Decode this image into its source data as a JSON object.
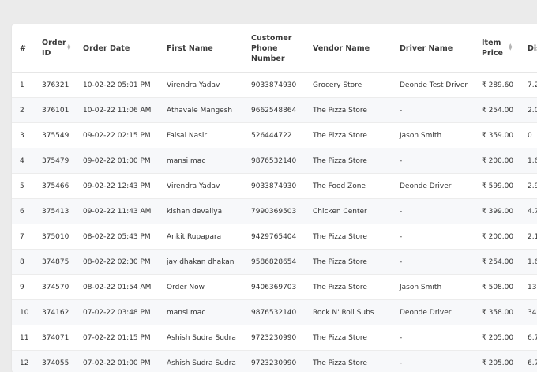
{
  "table": {
    "headers": {
      "index": "#",
      "order_id": "Order ID",
      "order_date": "Order Date",
      "first_name": "First Name",
      "customer_phone": "Customer Phone Number",
      "vendor_name": "Vendor Name",
      "driver_name": "Driver Name",
      "item_price": "Item Price",
      "discount": "Dis"
    },
    "sort_icon": "sort-updown-icon",
    "rows": [
      {
        "idx": "1",
        "order_id": "376321",
        "date": "10-02-22 05:01 PM",
        "first_name": "Virendra Yadav",
        "phone": "9033874930",
        "vendor": "Grocery Store",
        "driver": "Deonde Test Driver",
        "price": "₹ 289.60",
        "disc": "7.2"
      },
      {
        "idx": "2",
        "order_id": "376101",
        "date": "10-02-22 11:06 AM",
        "first_name": "Athavale Mangesh",
        "phone": "9662548864",
        "vendor": "The Pizza Store",
        "driver": "-",
        "price": "₹ 254.00",
        "disc": "2.0"
      },
      {
        "idx": "3",
        "order_id": "375549",
        "date": "09-02-22 02:15 PM",
        "first_name": "Faisal Nasir",
        "phone": "526444722",
        "vendor": "The Pizza Store",
        "driver": "Jason Smith",
        "price": "₹ 359.00",
        "disc": "0"
      },
      {
        "idx": "4",
        "order_id": "375479",
        "date": "09-02-22 01:00 PM",
        "first_name": "mansi mac",
        "phone": "9876532140",
        "vendor": "The Pizza Store",
        "driver": "-",
        "price": "₹ 200.00",
        "disc": "1.6"
      },
      {
        "idx": "5",
        "order_id": "375466",
        "date": "09-02-22 12:43 PM",
        "first_name": "Virendra Yadav",
        "phone": "9033874930",
        "vendor": "The Food Zone",
        "driver": "Deonde Driver",
        "price": "₹ 599.00",
        "disc": "2.9"
      },
      {
        "idx": "6",
        "order_id": "375413",
        "date": "09-02-22 11:43 AM",
        "first_name": "kishan devaliya",
        "phone": "7990369503",
        "vendor": "Chicken Center",
        "driver": "-",
        "price": "₹ 399.00",
        "disc": "4.7"
      },
      {
        "idx": "7",
        "order_id": "375010",
        "date": "08-02-22 05:43 PM",
        "first_name": "Ankit Rupapara",
        "phone": "9429765404",
        "vendor": "The Pizza Store",
        "driver": "-",
        "price": "₹ 200.00",
        "disc": "2.1"
      },
      {
        "idx": "8",
        "order_id": "374875",
        "date": "08-02-22 02:30 PM",
        "first_name": "jay dhakan dhakan",
        "phone": "9586828654",
        "vendor": "The Pizza Store",
        "driver": "-",
        "price": "₹ 254.00",
        "disc": "1.6"
      },
      {
        "idx": "9",
        "order_id": "374570",
        "date": "08-02-22 01:54 AM",
        "first_name": "Order Now",
        "phone": "9406369703",
        "vendor": "The Pizza Store",
        "driver": "Jason Smith",
        "price": "₹ 508.00",
        "disc": "13"
      },
      {
        "idx": "10",
        "order_id": "374162",
        "date": "07-02-22 03:48 PM",
        "first_name": "mansi mac",
        "phone": "9876532140",
        "vendor": "Rock N' Roll Subs",
        "driver": "Deonde Driver",
        "price": "₹ 358.00",
        "disc": "34"
      },
      {
        "idx": "11",
        "order_id": "374071",
        "date": "07-02-22 01:15 PM",
        "first_name": "Ashish Sudra Sudra",
        "phone": "9723230990",
        "vendor": "The Pizza Store",
        "driver": "-",
        "price": "₹ 205.00",
        "disc": "6.7"
      },
      {
        "idx": "12",
        "order_id": "374055",
        "date": "07-02-22 01:00 PM",
        "first_name": "Ashish Sudra Sudra",
        "phone": "9723230990",
        "vendor": "The Pizza Store",
        "driver": "-",
        "price": "₹ 205.00",
        "disc": "6.7"
      }
    ]
  }
}
